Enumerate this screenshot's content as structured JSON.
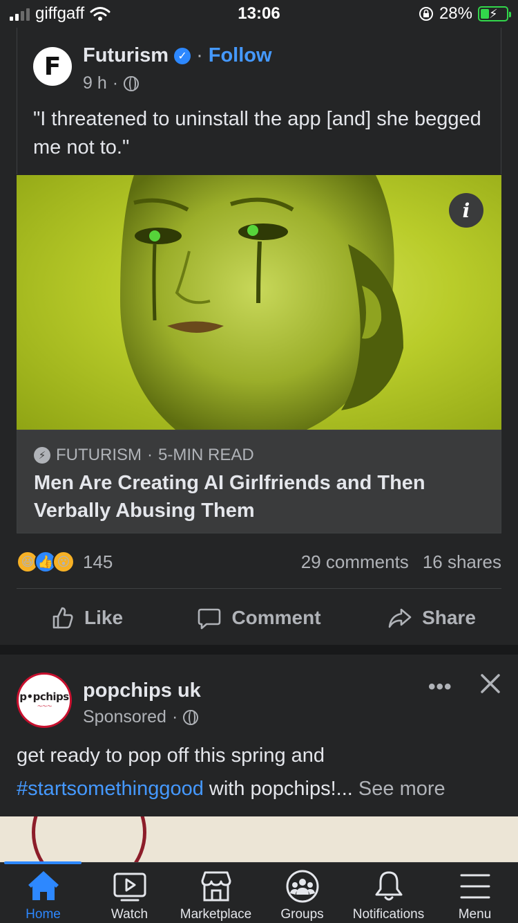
{
  "status_bar": {
    "carrier": "giffgaff",
    "time": "13:06",
    "battery_percent": "28%"
  },
  "post": {
    "author": "Futurism",
    "follow_label": "Follow",
    "time": "9 h",
    "text": "\"I threatened to uninstall the app [and] she begged me not to.\"",
    "link_source": "FUTURISM",
    "read_time": "5-MIN READ",
    "link_title": "Men Are Creating AI Girlfriends and Then Verbally Abusing Them",
    "reaction_count": "145",
    "comments": "29 comments",
    "shares": "16 shares",
    "actions": {
      "like": "Like",
      "comment": "Comment",
      "share": "Share"
    }
  },
  "sponsored": {
    "author": "popchips uk",
    "label": "Sponsored",
    "text_line1": "get ready to pop off this spring and",
    "hashtag": "#startsomethinggood",
    "text_line2": " with popchips!... ",
    "see_more": "See more"
  },
  "bottom_nav": {
    "items": [
      {
        "label": "Home",
        "icon": "home-icon"
      },
      {
        "label": "Watch",
        "icon": "video-icon"
      },
      {
        "label": "Marketplace",
        "icon": "store-icon"
      },
      {
        "label": "Groups",
        "icon": "groups-icon"
      },
      {
        "label": "Notifications",
        "icon": "bell-icon"
      },
      {
        "label": "Menu",
        "icon": "hamburger-icon"
      }
    ],
    "active": "Home"
  },
  "colors": {
    "background": "#18191a",
    "card": "#242526",
    "accent": "#2d88ff",
    "text_secondary": "#b0b3b8"
  }
}
